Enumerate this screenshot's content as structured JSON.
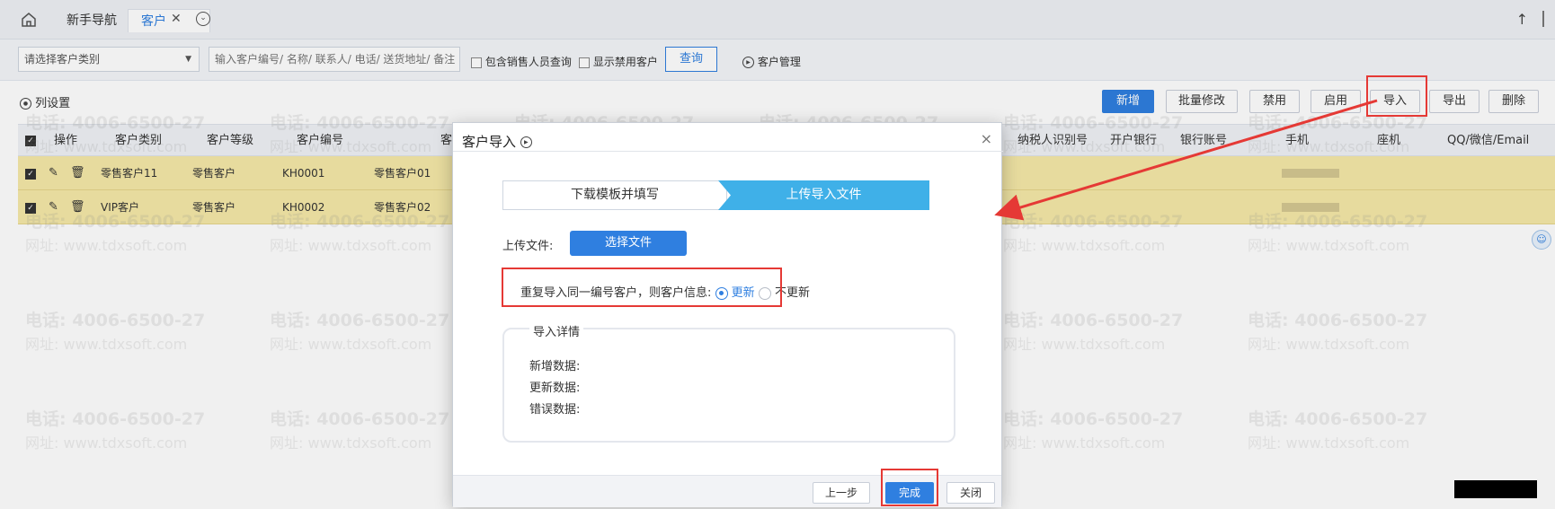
{
  "tabs": {
    "nav": "新手导航",
    "customer": "客户",
    "close": "✕"
  },
  "filter": {
    "type_select": "请选择客户类别",
    "search_placeholder": "输入客户编号/ 名称/ 联系人/ 电话/ 送货地址/ 备注",
    "include_sales": "包含销售人员查询",
    "show_disabled": "显示禁用客户",
    "query": "查询",
    "customer_management": "客户管理"
  },
  "toolbar": {
    "column_settings": "列设置",
    "add": "新增",
    "batch_edit": "批量修改",
    "disable": "禁用",
    "enable": "启用",
    "import": "导入",
    "export": "导出",
    "delete": "删除"
  },
  "table": {
    "headers": {
      "action": "操作",
      "category": "客户类别",
      "level": "客户等级",
      "code": "客户编号",
      "name": "客",
      "tax_id": "纳税人识别号",
      "bank": "开户银行",
      "bank_account": "银行账号",
      "mobile": "手机",
      "landline": "座机",
      "qq_wechat_email": "QQ/微信/Email"
    },
    "rows": [
      {
        "category": "零售客户11",
        "level": "零售客户",
        "code": "KH0001",
        "name": "零售客户01"
      },
      {
        "category": "VIP客户",
        "level": "零售客户",
        "code": "KH0002",
        "name": "零售客户02"
      }
    ]
  },
  "modal": {
    "title": "客户导入",
    "close": "×",
    "step1": "下载模板并填写",
    "step2": "上传导入文件",
    "upload_label": "上传文件:",
    "choose_file": "选择文件",
    "duplicate_text": "重复导入同一编号客户，则客户信息:",
    "option_update": "更新",
    "option_no_update": "不更新",
    "detail_title": "导入详情",
    "new_data": "新增数据:",
    "updated_data": "更新数据:",
    "error_data": "错误数据:",
    "prev": "上一步",
    "finish": "完成",
    "close_btn": "关闭"
  },
  "watermark": {
    "phone": "电话: 4006-6500-27",
    "website": "网址: www.tdxsoft.com"
  },
  "colors": {
    "primary": "#2f7fe0",
    "step_active": "#3fb0e8",
    "row_highlight": "#f6e9a8",
    "annotation_red": "#e53935"
  }
}
